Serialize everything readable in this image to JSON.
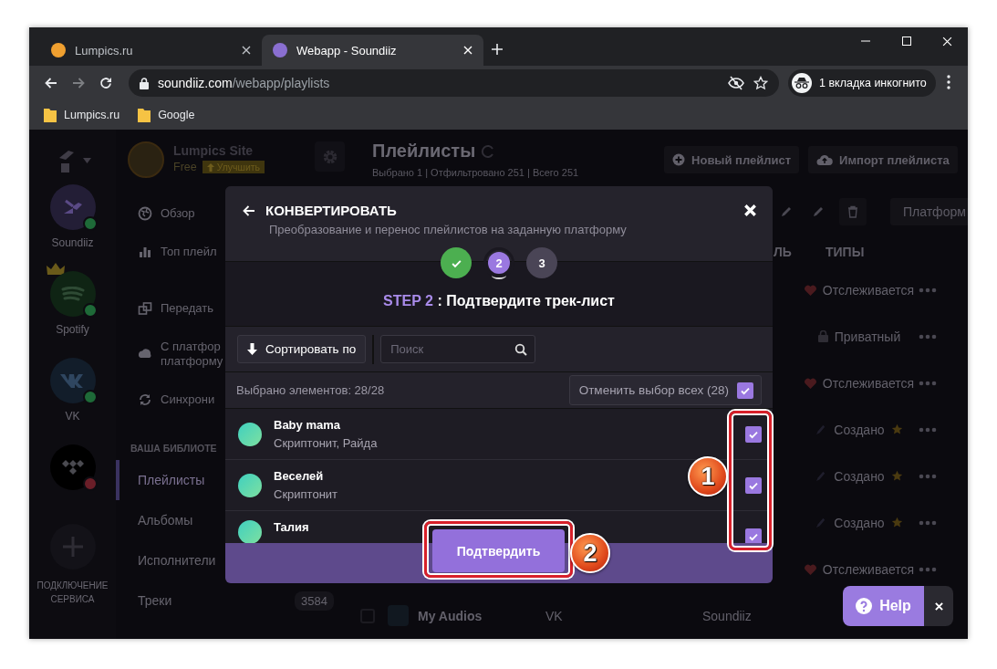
{
  "browser": {
    "tabs": [
      {
        "title": "Lumpics.ru",
        "selected": false
      },
      {
        "title": "Webapp - Soundiiz",
        "selected": true
      }
    ],
    "nav_buttons": [
      {
        "kind": "back",
        "disabled": false
      },
      {
        "kind": "forward",
        "disabled": true
      },
      {
        "kind": "reload",
        "disabled": false
      }
    ],
    "url": {
      "host": "soundiiz.com",
      "path": "/webapp/playlists"
    },
    "incognito": "1 вкладка инкогнито",
    "bookmarks": [
      "Lumpics.ru",
      "Google"
    ]
  },
  "services": [
    {
      "kind": "soundiiz",
      "name": "Soundiiz",
      "color": "#1e6a38",
      "premium": false
    },
    {
      "kind": "spotify",
      "name": "Spotify",
      "color": "#1e6a38",
      "premium": true
    },
    {
      "kind": "vk",
      "name": "VK",
      "color": "#1e6a38",
      "premium": false
    },
    {
      "kind": "tidal",
      "color": "#6a1e28",
      "premium": false
    }
  ],
  "add_service": "ПОДКЛЮЧЕНИЕ СЕРВИСА",
  "account": {
    "name": "Lumpics Site",
    "plan": "Free",
    "upgrade": "Улучшить"
  },
  "nav_main": [
    {
      "label": "Обзор",
      "selected": false
    },
    {
      "label": "Топ плейл",
      "selected": false
    }
  ],
  "nav_tools": [
    {
      "label": "Передать",
      "selected": false
    },
    {
      "label": "С платфор\nплатформу",
      "selected": false
    },
    {
      "label": "Синхрони",
      "selected": false
    }
  ],
  "library_heading": "ВАША БИБЛИОТЕ",
  "library": [
    {
      "label": "Плейлисты",
      "selected": true
    },
    {
      "label": "Альбомы",
      "selected": false
    },
    {
      "label": "Исполнители",
      "selected": false
    },
    {
      "label": "Треки",
      "count": "3584",
      "selected": false
    }
  ],
  "main": {
    "title": "Плейлисты",
    "subtitle": "Выбрано 1 | Отфильтровано 251 | Всего 251",
    "actions": [
      {
        "label": "Новый плейлист"
      },
      {
        "label": "Импорт плейлиста"
      }
    ],
    "platform_button": "Платформ",
    "columns": [
      "ЛЬ",
      "ТИПЫ"
    ],
    "types": [
      {
        "kind": "followed",
        "label": "Отслеживается"
      },
      {
        "kind": "private",
        "label": "Приватный"
      },
      {
        "kind": "followed",
        "label": "Отслеживается"
      },
      {
        "kind": "created",
        "label": "Создано"
      },
      {
        "kind": "created",
        "label": "Создано"
      },
      {
        "kind": "created",
        "label": "Создано"
      },
      {
        "kind": "followed",
        "label": "Отслеживается"
      }
    ],
    "last_row": {
      "checked": false,
      "name": "My Audios",
      "service": "VK",
      "owner": "Soundiiz"
    }
  },
  "help": "Help",
  "modal": {
    "title": "КОНВЕРТИРОВАТЬ",
    "subtitle": "Преобразование и перенос плейлистов на заданную платформу",
    "steps": [
      {
        "kind": "done"
      },
      {
        "kind": "current",
        "label": "2"
      },
      {
        "kind": "upcoming",
        "label": "3"
      }
    ],
    "step_prefix": "STEP 2",
    "step_text": ": Подтвердите трек-лист",
    "sort_button": "Сортировать по",
    "search": {
      "placeholder": "Поиск"
    },
    "selected_count": "Выбрано элементов: 28/28",
    "deselect": {
      "label": "Отменить выбор всех (28)",
      "checked": true
    },
    "tracks": [
      {
        "title": "Baby mama",
        "artist": "Скриптонит, Райда",
        "checked": true
      },
      {
        "title": "Веселей",
        "artist": "Скриптонит",
        "checked": true
      },
      {
        "title": "Талия",
        "checked": true
      }
    ],
    "confirm": "Подтвердить"
  },
  "callouts": [
    "1",
    "2"
  ]
}
